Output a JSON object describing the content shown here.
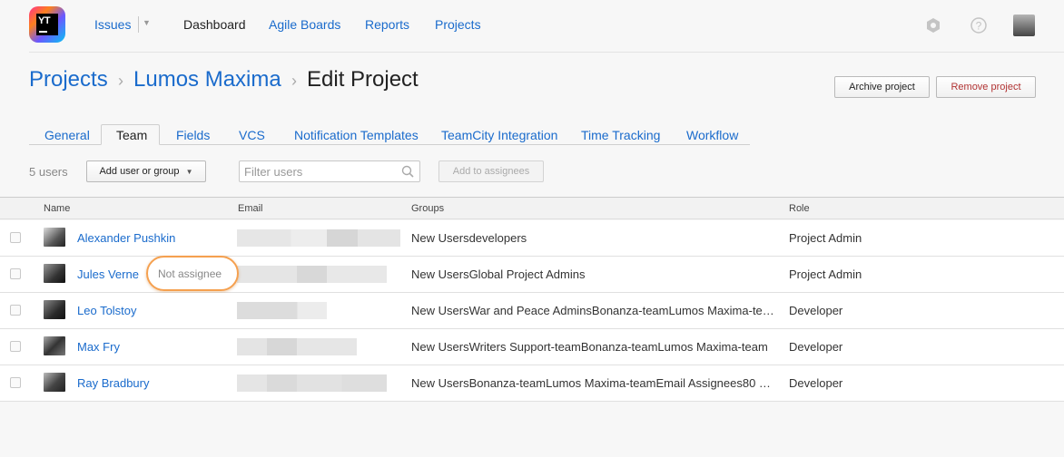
{
  "header": {
    "nav": {
      "issues": "Issues",
      "dashboard": "Dashboard",
      "agile_boards": "Agile Boards",
      "reports": "Reports",
      "projects": "Projects"
    },
    "logo_text": "YT",
    "icons": [
      "settings-icon",
      "help-icon",
      "user-avatar"
    ]
  },
  "breadcrumb": {
    "projects": "Projects",
    "project": "Lumos Maxima",
    "current": "Edit Project",
    "separator": "›"
  },
  "actions": {
    "archive": "Archive project",
    "remove": "Remove project"
  },
  "tabs": [
    "General",
    "Team",
    "Fields",
    "VCS",
    "Notification Templates",
    "TeamCity Integration",
    "Time Tracking",
    "Workflow"
  ],
  "toolbar": {
    "users_count": "5 users",
    "add_user": "Add user or group",
    "filter_placeholder": "Filter users",
    "add_to_assignees": "Add to assignees"
  },
  "table": {
    "columns": {
      "name": "Name",
      "email": "Email",
      "groups": "Groups",
      "role": "Role"
    },
    "rows": [
      {
        "name": "Alexander Pushkin",
        "groups": "New Usersdevelopers",
        "role": "Project Admin"
      },
      {
        "name": "Jules Verne",
        "badge": "Not assignee",
        "groups": "New UsersGlobal Project Admins",
        "role": "Project Admin"
      },
      {
        "name": "Leo Tolstoy",
        "groups": "New UsersWar and Peace AdminsBonanza-teamLumos Maxima-te…",
        "role": "Developer"
      },
      {
        "name": "Max Fry",
        "groups": "New UsersWriters Support-teamBonanza-teamLumos Maxima-team",
        "role": "Developer"
      },
      {
        "name": "Ray Bradbury",
        "groups": "New UsersBonanza-teamLumos Maxima-teamEmail Assignees80 …",
        "role": "Developer"
      }
    ]
  },
  "colors": {
    "link": "#1a6bcc",
    "badge_highlight": "#f5a04f",
    "remove_text": "#b13232"
  }
}
